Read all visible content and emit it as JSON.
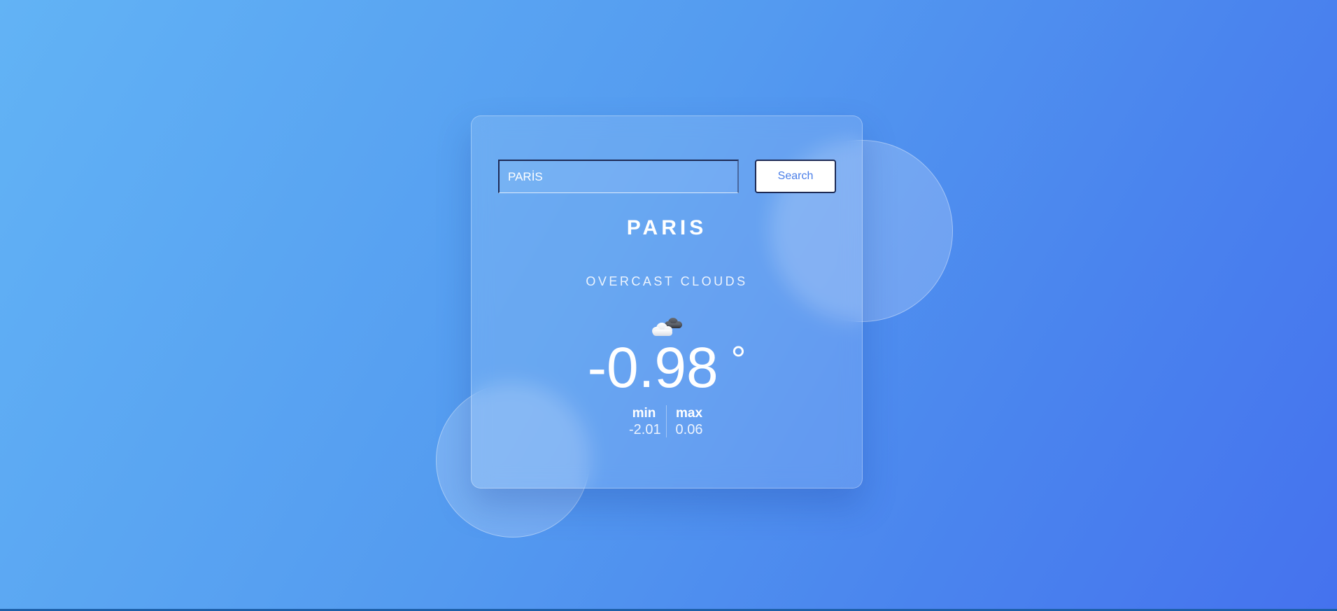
{
  "search": {
    "value": "PARİS",
    "button_label": "Search"
  },
  "weather": {
    "city": "PARIS",
    "description": "OVERCAST CLOUDS",
    "icon": "cloud-icon",
    "temperature": "-0.98",
    "degree_symbol": "°",
    "min_label": "min",
    "min_value": "-2.01",
    "max_label": "max",
    "max_value": "0.06"
  },
  "colors": {
    "background_start": "#62b3f5",
    "background_end": "#4572ee",
    "button_text": "#4a7ee8"
  }
}
